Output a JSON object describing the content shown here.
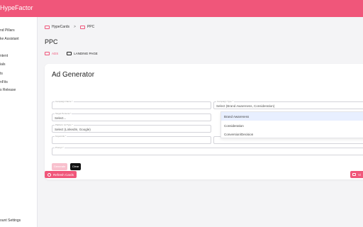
{
  "app": {
    "brand": "HypeFactor"
  },
  "sidebar": {
    "items": [
      {
        "label": "nd Pillars"
      },
      {
        "label": "ke Assistant"
      },
      {
        "label": "ntent"
      },
      {
        "label": "ials"
      },
      {
        "label": "ts"
      },
      {
        "label": "nFits"
      },
      {
        "label": "s Release"
      },
      {
        "label": ""
      }
    ],
    "footer_label": "ount Settings"
  },
  "breadcrumb": {
    "root": "HypeCards",
    "separator": ">",
    "current": "PPC"
  },
  "page": {
    "title": "PPC"
  },
  "tabs": [
    {
      "label": "ADS",
      "icon": "ads-icon",
      "active": true
    },
    {
      "label": "LANDING PAGE",
      "icon": "monitor-icon",
      "active": false
    }
  ],
  "ad_generator": {
    "title": "Ad Generator",
    "fields": {
      "campaign_name": {
        "label": "Campaign Name *",
        "value": ""
      },
      "campaign_type": {
        "label": "Campaign Type *",
        "value": "Select (Brand Awareness, Consideration)"
      },
      "target_persona": {
        "label": "Target Persona *",
        "value": "Select..."
      },
      "platform_ad_type": {
        "label": "Platform Ad Type *",
        "value": "Select (LinkedIn, Google)"
      },
      "keywords": {
        "label": "Keywords *",
        "value": ""
      },
      "extra": {
        "label": "",
        "value": ""
      },
      "prompt": {
        "label": "Prompt *",
        "value": ""
      }
    },
    "campaign_type_options": [
      {
        "label": "Brand Awareness",
        "selected": true
      },
      {
        "label": "Consideration",
        "selected": false
      },
      {
        "label": "Conversion/Decision",
        "selected": false
      }
    ],
    "generate_label": "Generate",
    "clear_label": "Clear"
  },
  "actions": {
    "refresh_label": "Refresh Cards",
    "right_label": "Vi"
  },
  "colors": {
    "accent": "#f0567a",
    "accent_light": "#f8c0cd",
    "selected_option": "#e8efff"
  }
}
